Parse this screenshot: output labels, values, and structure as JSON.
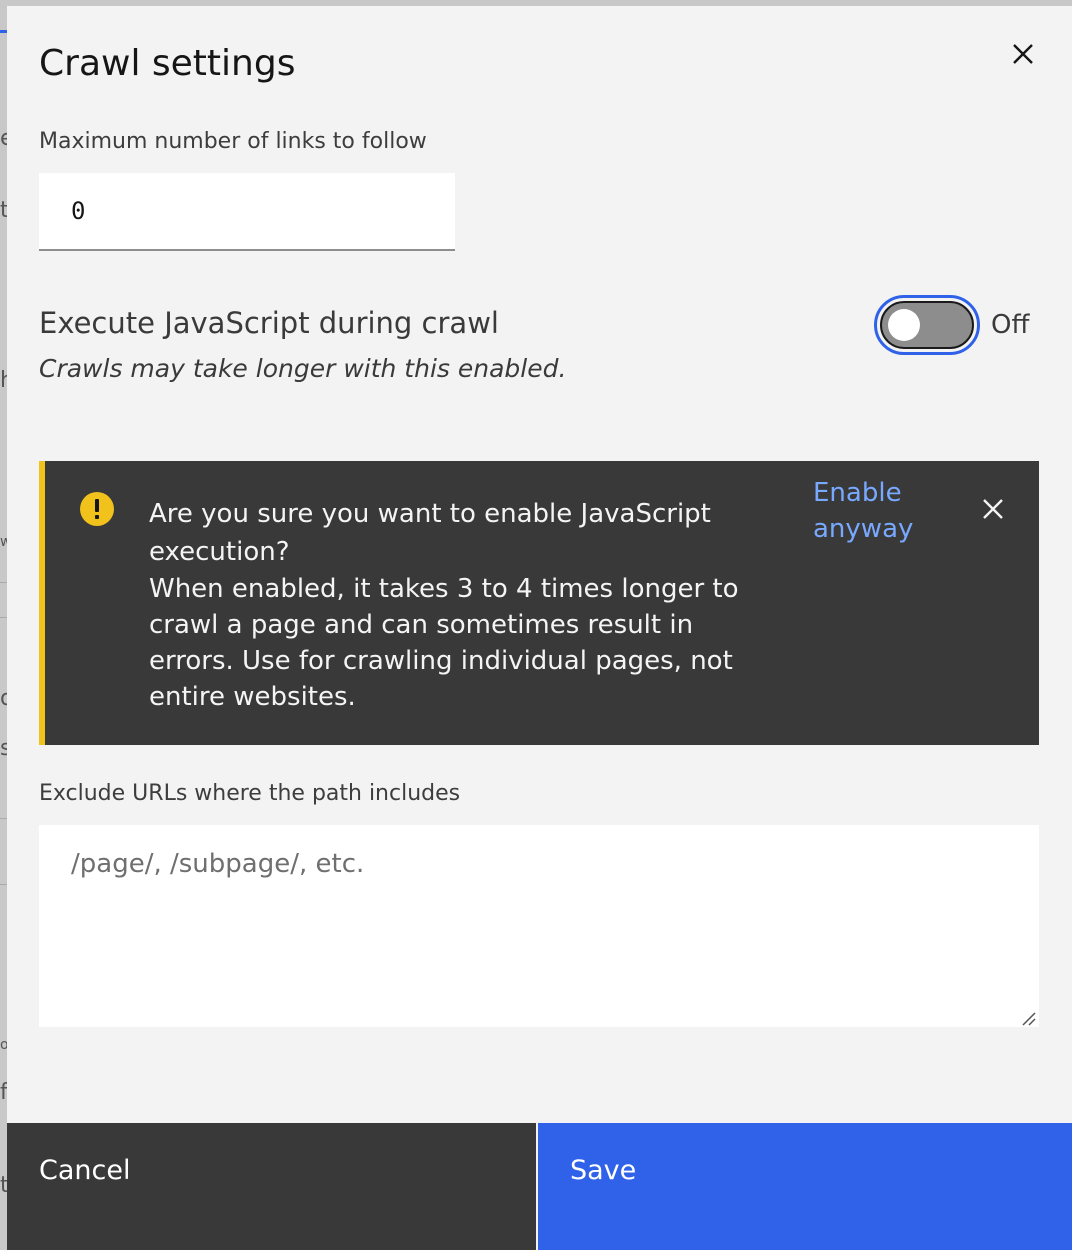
{
  "background_fragments": [
    "e",
    "t",
    "h",
    "w",
    "o",
    "s",
    "o",
    "f",
    "t"
  ],
  "dialog": {
    "title": "Crawl settings",
    "close_icon": "close-icon"
  },
  "max_links": {
    "label": "Maximum number of links to follow",
    "value": "0"
  },
  "javascript_toggle": {
    "heading": "Execute JavaScript during crawl",
    "subtext": "Crawls may take longer with this enabled.",
    "state_label": "Off",
    "checked": false
  },
  "warning": {
    "icon": "warning-icon",
    "title": "Are you sure you want to enable JavaScript execution?",
    "body": "When enabled, it takes 3 to 4 times longer to crawl a page and can sometimes result in errors. Use for crawling individual pages, not entire websites.",
    "action_label": "Enable anyway",
    "close_icon": "close-icon"
  },
  "exclude_urls": {
    "label": "Exclude URLs where the path includes",
    "placeholder": "/page/, /subpage/, etc.",
    "value": ""
  },
  "footer": {
    "cancel_label": "Cancel",
    "save_label": "Save"
  },
  "colors": {
    "primary": "#2f62e9",
    "warning": "#f1c21b",
    "notification_bg": "#393939",
    "link": "#78a9ff",
    "modal_bg": "#f3f3f3"
  }
}
